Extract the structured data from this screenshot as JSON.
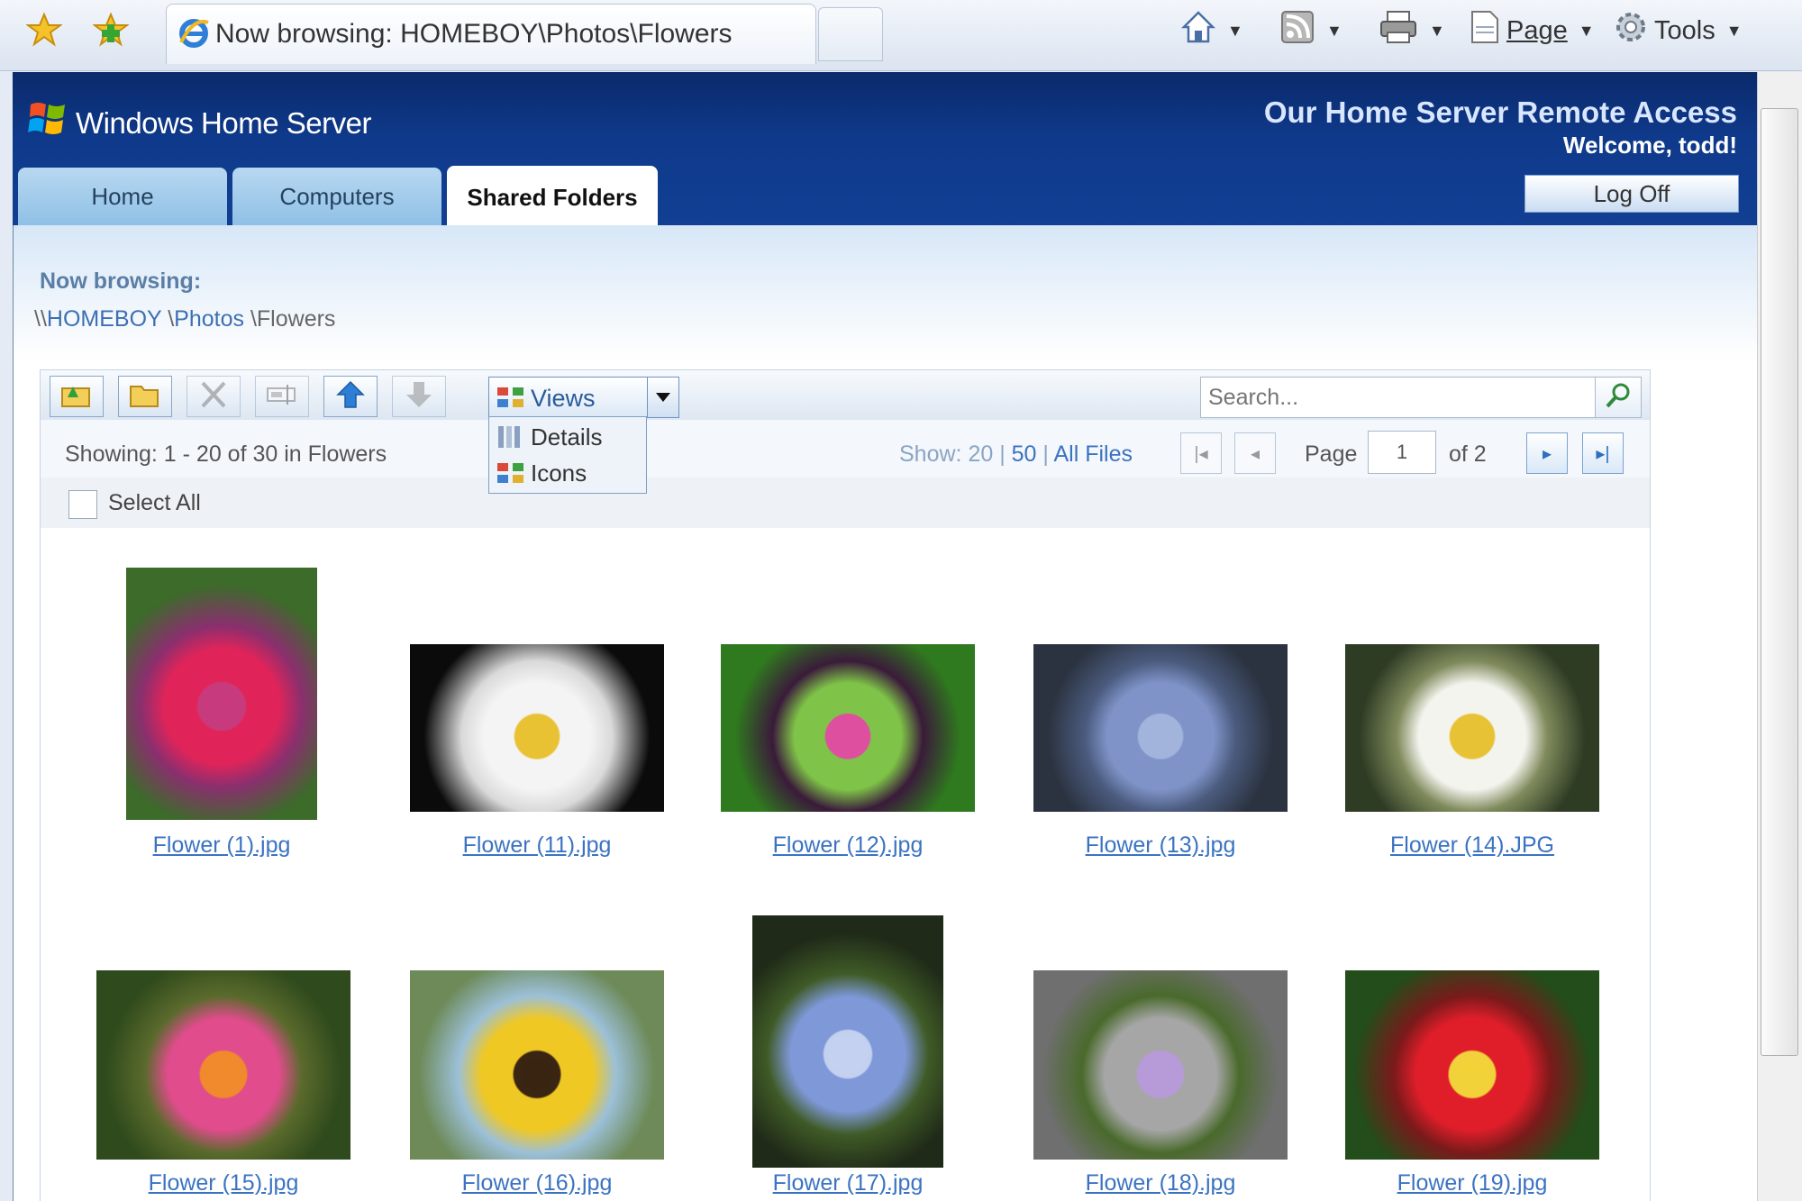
{
  "browser": {
    "tab_title": "Now browsing: HOMEBOY\\Photos\\Flowers",
    "commands": {
      "page": "Page",
      "tools": "Tools"
    }
  },
  "whs": {
    "brand": "Windows Home Server",
    "remote_title": "Our Home Server Remote Access",
    "welcome": "Welcome, todd!",
    "logoff": "Log Off",
    "tabs": [
      {
        "label": "Home",
        "active": false
      },
      {
        "label": "Computers",
        "active": false
      },
      {
        "label": "Shared Folders",
        "active": true
      }
    ]
  },
  "browse": {
    "label": "Now browsing:",
    "path_prefix": "\\\\",
    "crumbs": [
      "HOMEBOY",
      "Photos",
      "Flowers"
    ],
    "sep": "\\"
  },
  "toolbar": {
    "views_label": "Views",
    "views_menu": [
      "Details",
      "Icons"
    ],
    "search_placeholder": "Search..."
  },
  "paging": {
    "showing": "Showing: 1 - 20 of 30 in Flowers",
    "show_label": "Show:",
    "sizes": [
      "20",
      "50",
      "All Files"
    ],
    "page_label": "Page",
    "page_value": "1",
    "of_label": "of 2",
    "select_all": "Select All"
  },
  "files": [
    {
      "name": "Flower (1).jpg",
      "palette": [
        "#3c6b2a",
        "#e0245a",
        "#c73b7d",
        "#8a2f6e"
      ]
    },
    {
      "name": "Flower (11).jpg",
      "palette": [
        "#0b0b0b",
        "#f4f4f4",
        "#e8c232",
        "#d9d9d9"
      ]
    },
    {
      "name": "Flower (12).jpg",
      "palette": [
        "#2f7a1e",
        "#7fc448",
        "#de4fa0",
        "#3a1b3a"
      ]
    },
    {
      "name": "Flower (13).jpg",
      "palette": [
        "#2b3340",
        "#7f93c8",
        "#a3b4dc",
        "#4b5b7e"
      ]
    },
    {
      "name": "Flower (14).JPG",
      "palette": [
        "#2f3c24",
        "#f4f4ee",
        "#e6c234",
        "#7f8a5c"
      ]
    },
    {
      "name": "Flower (15).jpg",
      "palette": [
        "#2f4a1c",
        "#e04c8c",
        "#f08a2c",
        "#5a6a2c"
      ]
    },
    {
      "name": "Flower (16).jpg",
      "palette": [
        "#6d8a58",
        "#f0c823",
        "#3a2412",
        "#9cc0d8"
      ]
    },
    {
      "name": "Flower (17).jpg",
      "palette": [
        "#1f2a18",
        "#7e98d8",
        "#c4d0f0",
        "#3f5a26"
      ]
    },
    {
      "name": "Flower (18).jpg",
      "palette": [
        "#6f6f6f",
        "#a6a6a6",
        "#b79ad8",
        "#4a6a2c"
      ]
    },
    {
      "name": "Flower (19).jpg",
      "palette": [
        "#234d1a",
        "#e01e2a",
        "#f2d23a",
        "#7a1a1a"
      ]
    }
  ]
}
